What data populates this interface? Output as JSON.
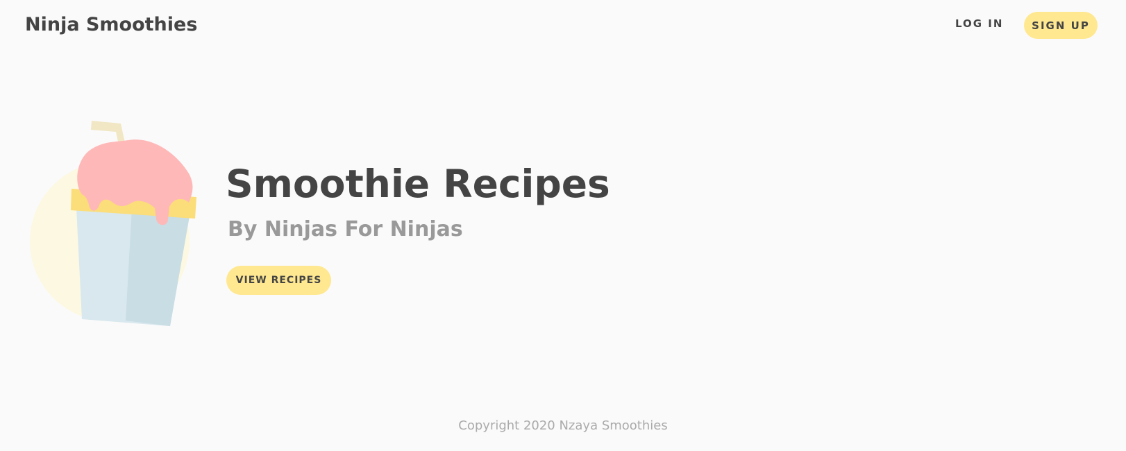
{
  "nav": {
    "brand": "Ninja Smoothies",
    "login_label": "LOG IN",
    "signup_label": "SIGN UP"
  },
  "hero": {
    "title": "Smoothie Recipes",
    "subtitle": "By Ninjas For Ninjas",
    "cta_label": "VIEW RECIPES",
    "illustration": "smoothie-cup-illustration"
  },
  "footer": {
    "copyright": "Copyright 2020 Nzaya Smoothies"
  },
  "colors": {
    "background": "#fafafa",
    "accent": "#ffe890",
    "text_dark": "#444444",
    "text_muted": "#999999",
    "smoothie_pink": "#ffb8b8",
    "cup_blue": "#d9e8ee"
  }
}
